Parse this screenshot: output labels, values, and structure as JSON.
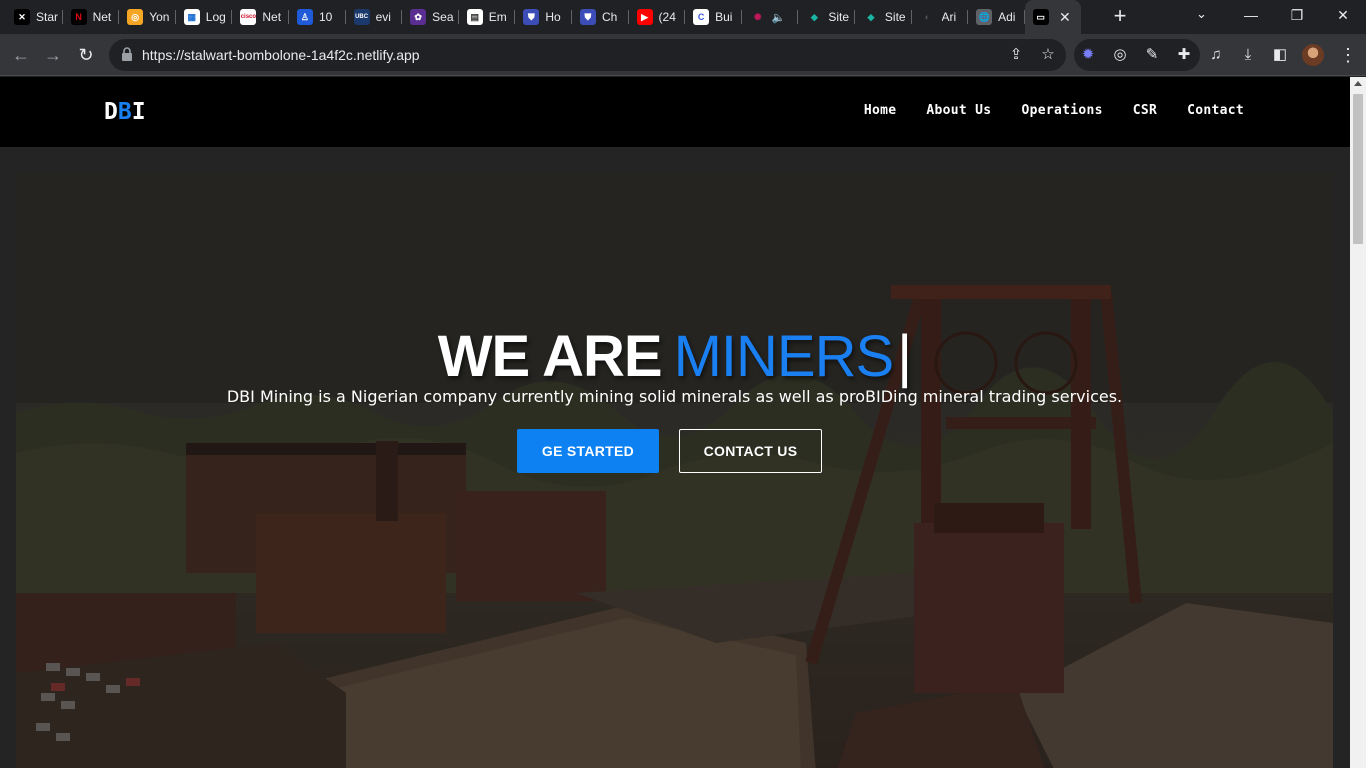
{
  "browser": {
    "tabs": [
      {
        "label": "Star",
        "color": "#000000",
        "glyph": "✕"
      },
      {
        "label": "Net",
        "color": "#000000",
        "glyph": "N",
        "glyph_color": "#e50914"
      },
      {
        "label": "Yon",
        "color": "#f6a623",
        "glyph": "◎"
      },
      {
        "label": "Log",
        "color": "#ffffff",
        "glyph": "▦",
        "glyph_color": "#1b6fd1"
      },
      {
        "label": "Net",
        "color": "#ffffff",
        "glyph": "cisco",
        "glyph_color": "#d0112b"
      },
      {
        "label": "10",
        "color": "#1f5bd8",
        "glyph": "♙"
      },
      {
        "label": "evi",
        "color": "#1b3a6b",
        "glyph": "UBC"
      },
      {
        "label": "Sea",
        "color": "#5a2d91",
        "glyph": "✿"
      },
      {
        "label": "Em",
        "color": "#ffffff",
        "glyph": "▤",
        "glyph_color": "#333333"
      },
      {
        "label": "Ho",
        "color": "#3d4db7",
        "glyph": "⛊"
      },
      {
        "label": "Ch",
        "color": "#3d4db7",
        "glyph": "⛊"
      },
      {
        "label": "(24",
        "color": "#ff0000",
        "glyph": "▶"
      },
      {
        "label": "Bui",
        "color": "#ffffff",
        "glyph": "C",
        "glyph_color": "#3b5bdb"
      },
      {
        "label": "",
        "color": "#202124",
        "glyph": "✺",
        "glyph_color": "#c2185b",
        "audio": "🔈"
      },
      {
        "label": "Site",
        "color": "#202124",
        "glyph": "◆",
        "glyph_color": "#1bb5a5"
      },
      {
        "label": "Site",
        "color": "#202124",
        "glyph": "◆",
        "glyph_color": "#1bb5a5"
      },
      {
        "label": "Ari",
        "color": "#202124",
        "glyph": "◐",
        "glyph_color": "#555555"
      },
      {
        "label": "Adi",
        "color": "#5f6368",
        "glyph": "🌐"
      },
      {
        "label": "",
        "color": "#000000",
        "glyph": "▭",
        "active": true
      }
    ],
    "new_tab": "+",
    "url": "https://stalwart-bombolone-1a4f2c.netlify.app",
    "icons": {
      "back": "arrow-left-icon",
      "forward": "arrow-right-icon",
      "reload": "reload-icon",
      "lock": "lock-icon",
      "share": "share-icon",
      "bookmark": "star-icon",
      "extensions": "puzzle-icon",
      "downloads": "download-icon"
    }
  },
  "site": {
    "logo_pre": "D",
    "logo_mid": "B",
    "logo_post": "I",
    "nav": [
      "Home",
      "About Us",
      "Operations",
      "CSR",
      "Contact"
    ],
    "hero": {
      "headline_white": "WE ARE",
      "headline_blue": "MINERS",
      "cursor": "|",
      "subtitle": "DBI Mining is a Nigerian company currently mining solid minerals as well as proBIDing mineral trading services.",
      "primary_button": "GE STARTED",
      "secondary_button": "CONTACT US"
    },
    "colors": {
      "accent": "#1a7ff0",
      "nav_bg": "#000000"
    }
  }
}
